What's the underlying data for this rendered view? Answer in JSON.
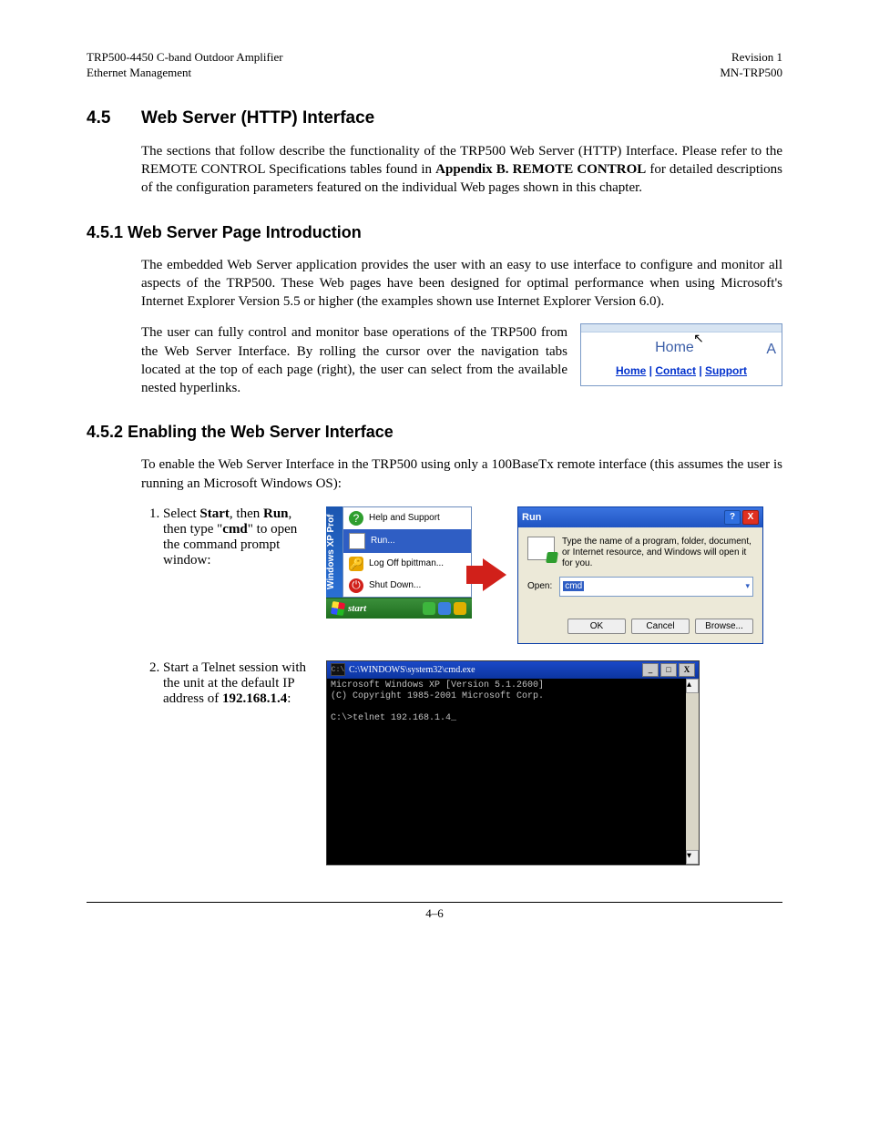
{
  "header": {
    "left1": "TRP500-4450 C-band Outdoor Amplifier",
    "left2": "Ethernet Management",
    "right1": "Revision 1",
    "right2": "MN-TRP500"
  },
  "s45": {
    "num": "4.5",
    "title": "Web Server (HTTP) Interface",
    "p1a": "The sections that follow describe the functionality of the TRP500 Web Server (HTTP) Interface. Please refer to the REMOTE CONTROL Specifications tables found in ",
    "p1b": "Appendix B. REMOTE CONTROL",
    "p1c": " for detailed descriptions of the configuration parameters featured on the individual Web pages shown in this chapter."
  },
  "s451": {
    "num": "4.5.1",
    "title": "Web Server Page Introduction",
    "p1": "The embedded Web Server application provides the user with an easy to use interface to configure and monitor all aspects of the TRP500. These Web pages have been designed for optimal performance when using Microsoft's Internet Explorer Version 5.5 or higher (the examples shown use Internet Explorer Version 6.0).",
    "p2": "The user can fully control and monitor base operations of the TRP500 from the Web Server Interface. By rolling the cursor over the navigation tabs located at the top of each page (right), the user can select from the available nested hyperlinks.",
    "tabfig": {
      "home": "Home",
      "ac": "A",
      "links": [
        "Home",
        "Contact",
        "Support"
      ]
    }
  },
  "s452": {
    "num": "4.5.2",
    "title": "Enabling the Web Server Interface",
    "p1": "To enable the Web Server Interface in the TRP500 using only a 100BaseTx remote interface (this assumes the user is running an Microsoft Windows OS):",
    "step1": {
      "a": "Select ",
      "b": "Start",
      "c": ", then ",
      "d": "Run",
      "e": ", then type \"",
      "f": "cmd",
      "g": "\" to open the command prompt window:"
    },
    "step2": {
      "a": "Start a Telnet session with the unit at the default IP address of ",
      "b": "192.168.1.4",
      "c": ":"
    }
  },
  "startmenu": {
    "sidebar": "Windows XP  Prof",
    "items": [
      {
        "icon": "?",
        "iconbg": "#2f9e2f",
        "label": "Help and Support"
      },
      {
        "icon": "▭",
        "iconbg": "#3b7fe0",
        "label": "Run...",
        "selected": true
      },
      {
        "icon": "🔑",
        "iconbg": "#e7a400",
        "label": "Log Off bpittman..."
      },
      {
        "icon": "⏻",
        "iconbg": "#d1201a",
        "label": "Shut Down..."
      }
    ],
    "startlabel": "start"
  },
  "rundialog": {
    "title": "Run",
    "desc": "Type the name of a program, folder, document, or Internet resource, and Windows will open it for you.",
    "openlabel": "Open:",
    "value": "cmd",
    "buttons": [
      "OK",
      "Cancel",
      "Browse..."
    ]
  },
  "cmd": {
    "title": "C:\\WINDOWS\\system32\\cmd.exe",
    "line1": "Microsoft Windows XP [Version 5.1.2600]",
    "line2": "(C) Copyright 1985-2001 Microsoft Corp.",
    "line3": "C:\\>telnet 192.168.1.4_"
  },
  "footer": {
    "page": "4–6"
  }
}
